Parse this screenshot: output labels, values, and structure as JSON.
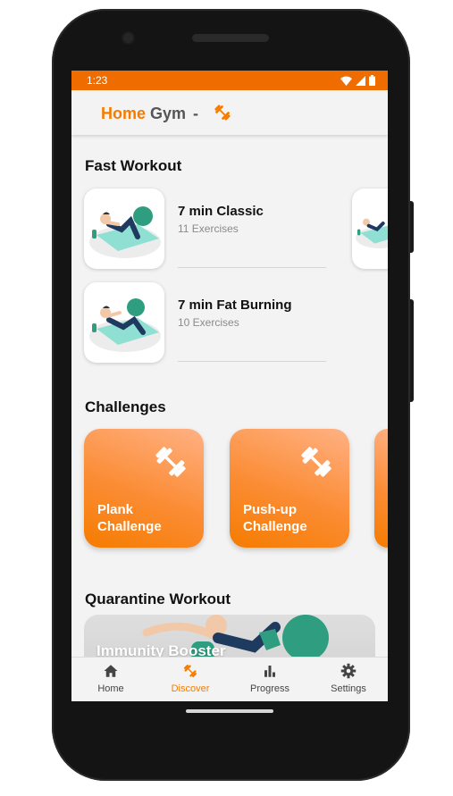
{
  "status_bar": {
    "time": "1:23"
  },
  "app_bar": {
    "title_part1": "Home",
    "title_part2": "Gym",
    "separator": "-",
    "icon": "dumbbell-icon"
  },
  "sections": {
    "fast_workout": "Fast Workout",
    "challenges": "Challenges",
    "quarantine": "Quarantine Workout"
  },
  "fast_workouts": [
    {
      "name": "7 min Classic",
      "sub": "11 Exercises"
    },
    {
      "name": "7 min Fat Burning",
      "sub": "10 Exercises"
    }
  ],
  "challenges": [
    {
      "label": "Plank\nChallenge"
    },
    {
      "label": "Push-up\nChallenge"
    }
  ],
  "quarantine_card": {
    "label": "Immunity Booster"
  },
  "bottom_nav": [
    {
      "label": "Home",
      "icon": "home-icon"
    },
    {
      "label": "Discover",
      "icon": "dumbbell-icon",
      "active": true
    },
    {
      "label": "Progress",
      "icon": "bar-chart-icon"
    },
    {
      "label": "Settings",
      "icon": "gear-icon"
    }
  ],
  "colors": {
    "accent": "#f57c00",
    "status_bar": "#ef6c00",
    "background": "#f3f3f3"
  }
}
